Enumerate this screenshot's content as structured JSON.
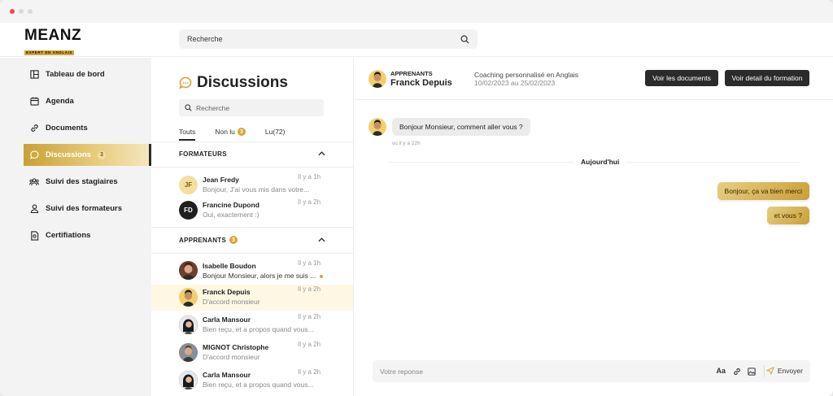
{
  "brand": {
    "name": "MEANZ",
    "tagline": "EXPERT EN ANGLAIS"
  },
  "header": {
    "search_placeholder": "Recherche"
  },
  "sidebar": {
    "items": [
      {
        "label": "Tableau de bord",
        "icon": "dashboard-icon"
      },
      {
        "label": "Agenda",
        "icon": "calendar-icon"
      },
      {
        "label": "Documents",
        "icon": "link-icon"
      },
      {
        "label": "Discussions",
        "icon": "chat-icon",
        "badge": "3",
        "active": true
      },
      {
        "label": "Suivi des stagiaires",
        "icon": "group-icon"
      },
      {
        "label": "Suivi des formateurs",
        "icon": "user-icon"
      },
      {
        "label": "Certifiations",
        "icon": "certificate-icon"
      }
    ]
  },
  "conversations": {
    "title": "Discussions",
    "search_placeholder": "Recherche",
    "tabs": [
      {
        "label": "Touts",
        "active": true
      },
      {
        "label": "Non lu",
        "badge": "3"
      },
      {
        "label": "Lu(72)"
      }
    ],
    "formateurs": {
      "title": "FORMATEURS",
      "items": [
        {
          "initials": "JF",
          "name": "Jean Fredy",
          "message": "Bonjour, J'ai vous mis dans votre...",
          "time": "Il y a 1h"
        },
        {
          "initials": "FD",
          "name": "Francine Dupond",
          "message": "Oui, exactement :)",
          "time": "Il y a 2h"
        }
      ]
    },
    "apprenants": {
      "title": "APPRENANTS",
      "badge": "3",
      "items": [
        {
          "name": "Isabelle Boudon",
          "message": "Bonjour Monsieur, alors je me suis ...",
          "time": "Il y a 1h",
          "unread": true
        },
        {
          "name": "Franck Depuis",
          "message": "D'accord monsieur",
          "time": "Il y a 2h",
          "selected": true
        },
        {
          "name": "Carla Mansour",
          "message": "Bien reçu, et a propos quand vous...",
          "time": "Il y a 2h"
        },
        {
          "name": "MIGNOT Christophe",
          "message": "D'accord monsieur",
          "time": "Il y a 2h"
        },
        {
          "name": "Carla Mansour",
          "message": "Bien reçu, et a propos quand vous...",
          "time": "Il y a 2h"
        }
      ]
    }
  },
  "chat": {
    "role": "APPRENANTS",
    "contact": "Franck Depuis",
    "course": "Coaching personnalisé en Anglais",
    "dates": "10/02/2023 au 25/02/2023",
    "btn_documents": "Voir les documents",
    "btn_formation": "Voir detail du formation",
    "incoming": {
      "text": "Bonjour Monsieur, comment aller vous ?",
      "time": "vu il y a 22h"
    },
    "day_label": "Aujourd'hui",
    "outgoing": [
      "Bonjour, ça va bien merci",
      "et vous ?"
    ],
    "composer_placeholder": "Votre reponse",
    "font_label": "Aa",
    "send_label": "Envoyer"
  },
  "colors": {
    "accent": "#d4a63a",
    "dark": "#2b2b2b"
  }
}
